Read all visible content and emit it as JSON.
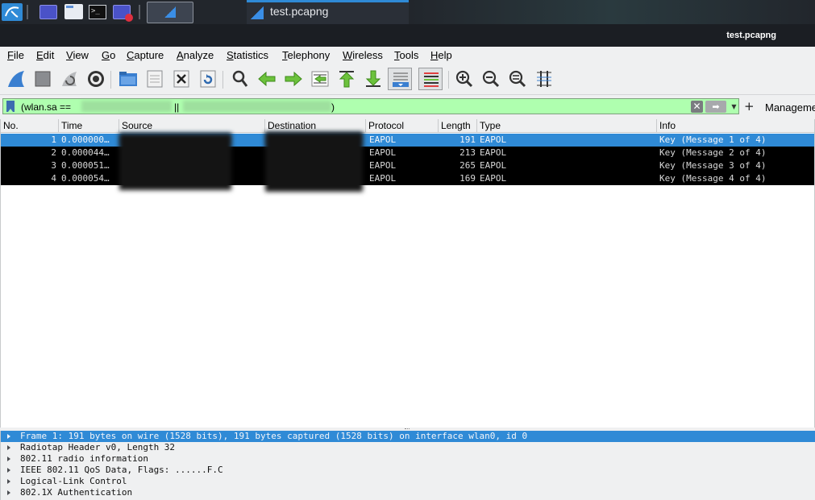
{
  "taskbar": {
    "window_title": "test.pcapng",
    "icons": [
      "kali-menu-icon",
      "terminal-window-icon",
      "file-manager-icon",
      "terminal-icon",
      "screen-recorder-icon",
      "wireshark-workspace-icon"
    ]
  },
  "window": {
    "title": "test.pcapng"
  },
  "menu": {
    "items": [
      "File",
      "Edit",
      "View",
      "Go",
      "Capture",
      "Analyze",
      "Statistics",
      "Telephony",
      "Wireless",
      "Tools",
      "Help"
    ]
  },
  "toolbar": {
    "buttons": [
      "start-capture-icon",
      "stop-capture-icon",
      "restart-capture-icon",
      "capture-options-icon",
      "open-file-icon",
      "save-file-icon",
      "close-file-icon",
      "reload-file-icon",
      "find-packet-icon",
      "go-back-icon",
      "go-forward-icon",
      "go-to-packet-icon",
      "first-packet-icon",
      "last-packet-icon",
      "auto-scroll-icon",
      "colorize-icon",
      "zoom-in-icon",
      "zoom-out-icon",
      "normal-size-icon",
      "resize-columns-icon"
    ]
  },
  "filter": {
    "text_start": "(wlan.sa ==",
    "text_mid": "||",
    "text_end": ")",
    "background": "#afffaf"
  },
  "management_label": "Manageme",
  "packet_list": {
    "columns": [
      "No.",
      "Time",
      "Source",
      "Destination",
      "Protocol",
      "Length",
      "Type",
      "Info"
    ],
    "rows": [
      {
        "no": "1",
        "time": "0.000000…",
        "protocol": "EAPOL",
        "length": "191",
        "type": "EAPOL",
        "info": "Key (Message 1 of 4)",
        "selected": true
      },
      {
        "no": "2",
        "time": "0.000044…",
        "protocol": "EAPOL",
        "length": "213",
        "type": "EAPOL",
        "info": "Key (Message 2 of 4)",
        "selected": false
      },
      {
        "no": "3",
        "time": "0.000051…",
        "protocol": "EAPOL",
        "length": "265",
        "type": "EAPOL",
        "info": "Key (Message 3 of 4)",
        "selected": false
      },
      {
        "no": "4",
        "time": "0.000054…",
        "protocol": "EAPOL",
        "length": "169",
        "type": "EAPOL",
        "info": "Key (Message 4 of 4)",
        "selected": false
      }
    ]
  },
  "details": {
    "rows": [
      "Frame 1: 191 bytes on wire (1528 bits), 191 bytes captured (1528 bits) on interface wlan0, id 0",
      "Radiotap Header v0, Length 32",
      "802.11 radio information",
      "IEEE 802.11 QoS Data, Flags: ......F.C",
      "Logical-Link Control",
      "802.1X Authentication"
    ]
  },
  "colors": {
    "selection": "#2f8ad6",
    "row_background": "#000000",
    "filter_valid": "#afffaf"
  }
}
